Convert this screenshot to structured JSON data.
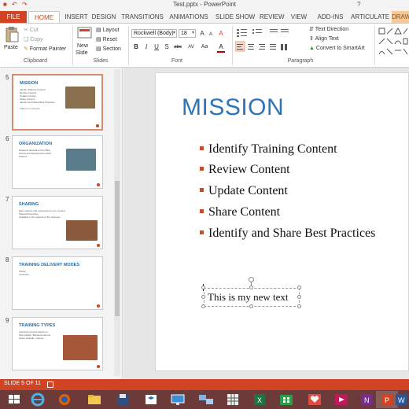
{
  "window": {
    "title": "Test.pptx - PowerPoint",
    "help_label": "?",
    "draw_tab": "DRAW"
  },
  "tabs": [
    "FILE",
    "HOME",
    "INSERT",
    "DESIGN",
    "TRANSITIONS",
    "ANIMATIONS",
    "SLIDE SHOW",
    "REVIEW",
    "VIEW",
    "ADD-INS",
    "ARTICULATE"
  ],
  "ribbon": {
    "clipboard": {
      "paste": "Paste",
      "cut": "Cut",
      "copy": "Copy",
      "format_painter": "Format Painter",
      "label": "Clipboard"
    },
    "slides": {
      "new_slide": "New",
      "new_slide_2": "Slide",
      "layout": "Layout",
      "reset": "Reset",
      "section": "Section",
      "label": "Slides"
    },
    "font": {
      "font_name": "Rockwell (Body)",
      "font_size": "18",
      "bold": "B",
      "italic": "I",
      "underline": "U",
      "shadow": "S",
      "strike": "abc",
      "spacing": "AV",
      "case": "Aa",
      "grow": "A",
      "shrink": "A",
      "clear": "A",
      "color": "A",
      "label": "Font"
    },
    "paragraph": {
      "text_direction": "Text Direction",
      "align_text": "Align Text",
      "convert_smartart": "Convert to SmartArt",
      "label": "Paragraph"
    }
  },
  "thumbnails": [
    {
      "number": "5",
      "title": "MISSION",
      "lines": [
        "Identify Training Content",
        "Review Content",
        "Update Content",
        "Share Content",
        "Identify and Share Best Practices",
        "",
        "This is my new text"
      ],
      "photo_color": "#8a6f4e",
      "active": true
    },
    {
      "number": "6",
      "title": "ORGANIZATION",
      "lines": [
        "Divisions head all of the Office",
        "Teams and Departments within",
        "Shared"
      ],
      "photo_color": "#5a7c8a",
      "active": false
    },
    {
      "number": "7",
      "title": "SHARING",
      "lines": [
        "Easy sharing and exchanges by key content",
        "Shared throughout",
        "Available in the network of the business"
      ],
      "photo_color": "#8b5a3c",
      "active": false
    },
    {
      "number": "8",
      "title": "TRAINING DELIVERY MODES",
      "lines": [
        "Virtual",
        "In-Person"
      ],
      "photo_color": "",
      "active": false
    },
    {
      "number": "9",
      "title": "TRAINING TYPES",
      "lines": [
        "Instructor-led and hands-on",
        "Self-guided / Blended learning",
        "Share Globally: training..."
      ],
      "photo_color": "#a8583a",
      "active": false
    }
  ],
  "slide": {
    "title": "MISSION",
    "bullets": [
      "Identify Training Content",
      "Review Content",
      "Update Content",
      "Share Content",
      "Identify and Share Best Practices"
    ],
    "textbox": "This is my new text"
  },
  "status": {
    "slide_counter": "SLIDE 5 OF 11"
  },
  "taskbar": {
    "items": [
      "start-button",
      "ie-icon",
      "explorer-icon",
      "file-explorer-icon",
      "save-icon",
      "dropbox-icon",
      "remote-desktop-icon",
      "network-icon",
      "grid-icon",
      "excel-icon",
      "store-icon",
      "health-icon",
      "video-icon",
      "onenote-icon",
      "powerpoint-icon",
      "word-icon"
    ]
  },
  "colors": {
    "accent": "#d04423",
    "title_blue": "#2b75b8",
    "bullet_marker": "#c0502f",
    "taskbar": "#6c3a38"
  }
}
